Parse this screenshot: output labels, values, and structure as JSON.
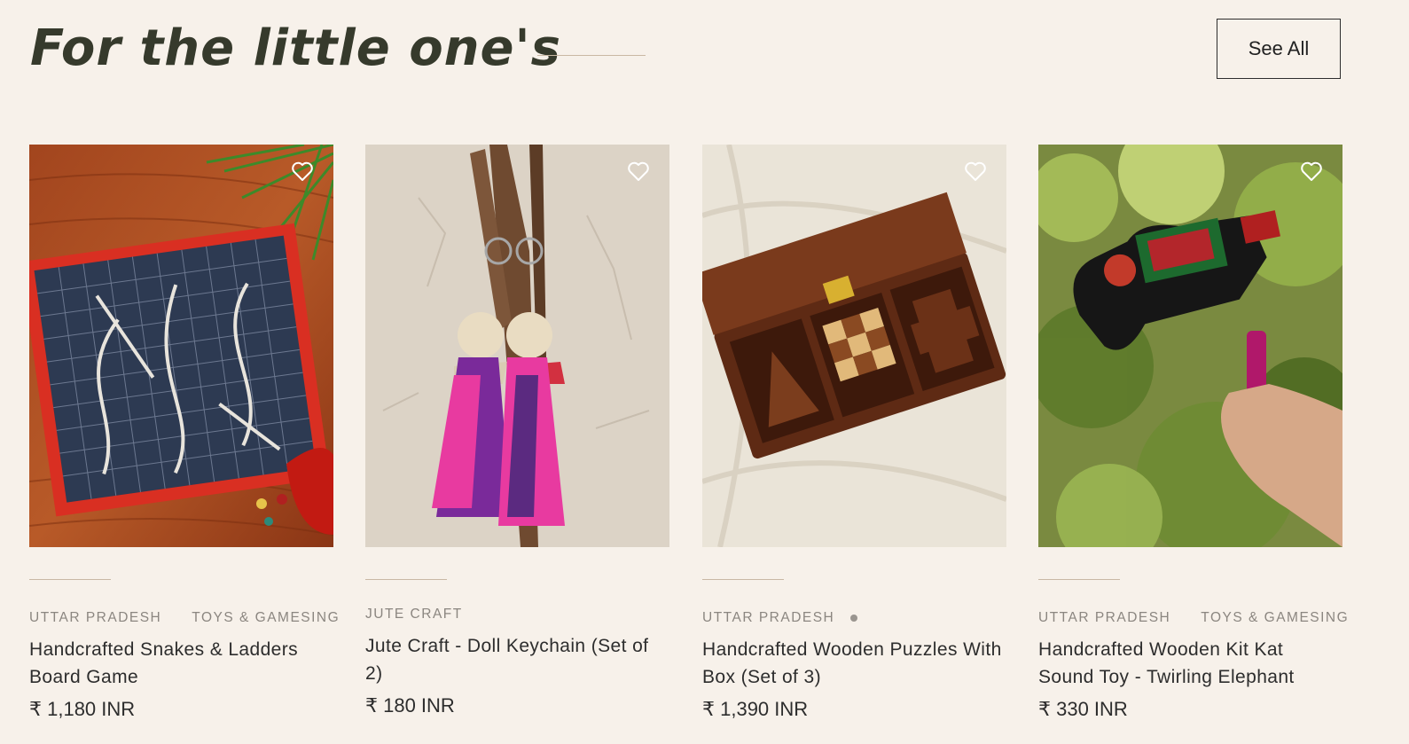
{
  "section": {
    "title": "For the little one's",
    "see_all_label": "See All"
  },
  "colors": {
    "background": "#f7f1ea",
    "title": "#363a2c",
    "meta": "#8b8680"
  },
  "products": [
    {
      "location": "UTTAR PRADESH",
      "category": "TOYS & GAMESING",
      "name": "Handcrafted Snakes & Ladders Board Game",
      "price": "₹ 1,180 INR",
      "icon": "heart-icon"
    },
    {
      "location": "JUTE CRAFT",
      "category": "",
      "name": "Jute Craft - Doll Keychain (Set of 2)",
      "price": "₹ 180 INR",
      "icon": "heart-icon"
    },
    {
      "location": "UTTAR PRADESH",
      "category": "",
      "name": "Handcrafted Wooden Puzzles With Box (Set of 3)",
      "price": "₹ 1,390 INR",
      "icon": "heart-icon"
    },
    {
      "location": "UTTAR PRADESH",
      "category": "TOYS & GAMESING",
      "name": "Handcrafted Wooden Kit Kat Sound Toy - Twirling Elephant",
      "price": "₹ 330 INR",
      "icon": "heart-icon"
    }
  ]
}
